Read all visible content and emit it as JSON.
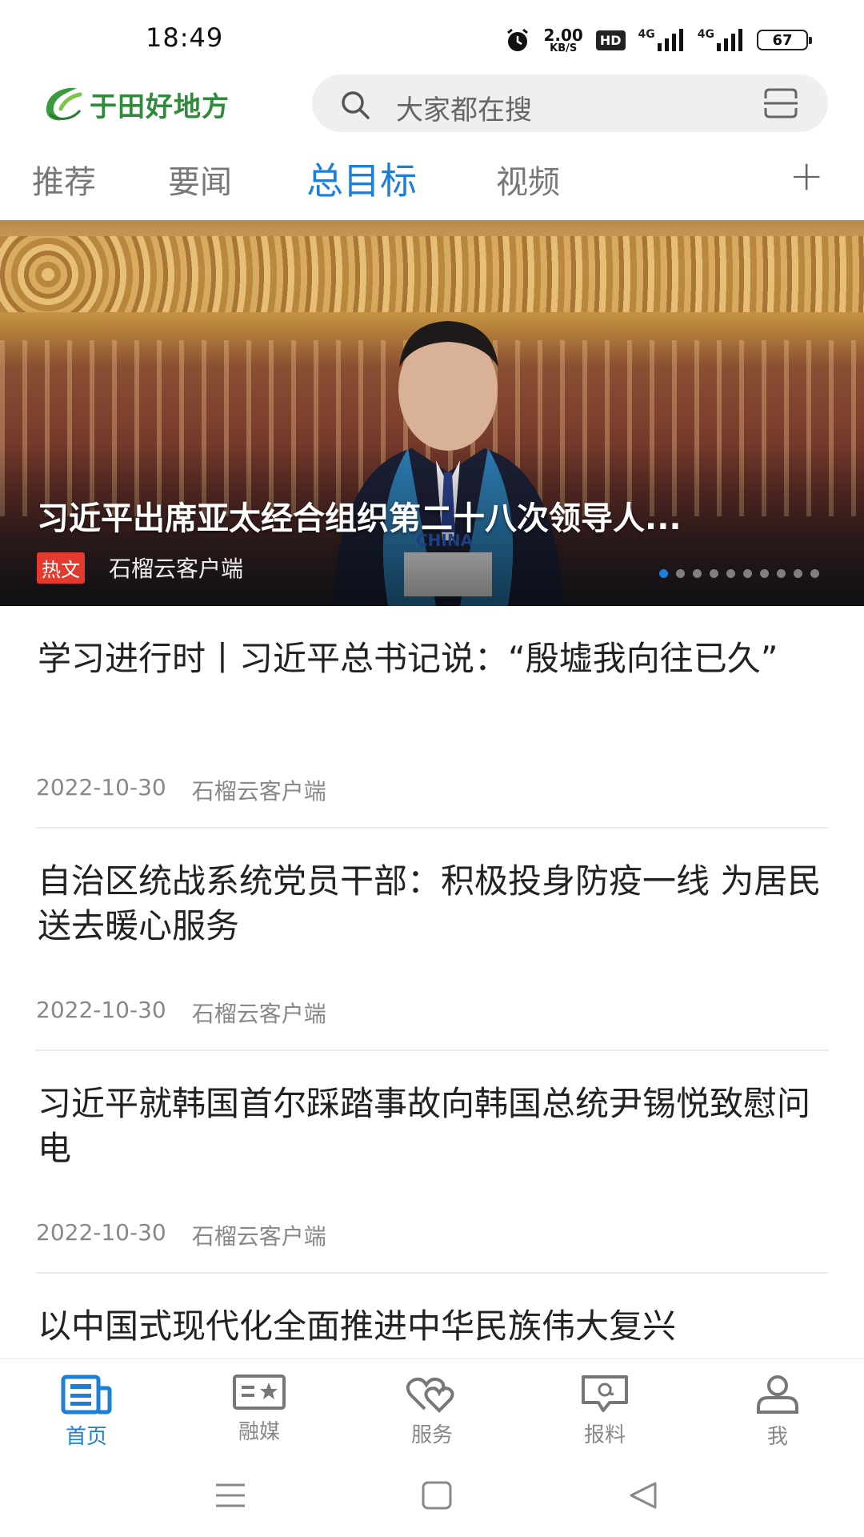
{
  "status_bar": {
    "time": "18:49",
    "net_speed_value": "2.00",
    "net_speed_unit": "KB/S",
    "hd_label": "HD",
    "signal1_label": "4G",
    "signal2_label": "4G",
    "battery": "67"
  },
  "header": {
    "logo_text": "于田好地方",
    "search_placeholder": "大家都在搜"
  },
  "tabs": [
    {
      "label": "推荐",
      "active": false
    },
    {
      "label": "要闻",
      "active": false
    },
    {
      "label": "总目标",
      "active": true
    },
    {
      "label": "视频",
      "active": false
    }
  ],
  "tab_add_label": "+",
  "banner": {
    "title": "习近平出席亚太经合组织第二十八次领导人...",
    "badge": "热文",
    "source": "石榴云客户端",
    "nameplate": "CHINA",
    "dot_count": 10,
    "active_dot": 0
  },
  "news": [
    {
      "title": "学习进行时丨习近平总书记说：“殷墟我向往已久”",
      "date": "2022-10-30",
      "source": "石榴云客户端"
    },
    {
      "title": "自治区统战系统党员干部：积极投身防疫一线 为居民送去暖心服务",
      "date": "2022-10-30",
      "source": "石榴云客户端"
    },
    {
      "title": "习近平就韩国首尔踩踏事故向韩国总统尹锡悦致慰问电",
      "date": "2022-10-30",
      "source": "石榴云客户端"
    },
    {
      "title": "以中国式现代化全面推进中华民族伟大复兴",
      "date": "",
      "source": ""
    }
  ],
  "bottom_nav": [
    {
      "label": "首页",
      "icon": "home-news-icon",
      "active": true
    },
    {
      "label": "融媒",
      "icon": "media-icon",
      "active": false
    },
    {
      "label": "服务",
      "icon": "service-hearts-icon",
      "active": false
    },
    {
      "label": "报料",
      "icon": "report-chat-icon",
      "active": false
    },
    {
      "label": "我",
      "icon": "user-icon",
      "active": false
    }
  ],
  "colors": {
    "accent": "#1d7fd6",
    "logo_green": "#2e8b3a",
    "hot_badge": "#e23b2e"
  }
}
